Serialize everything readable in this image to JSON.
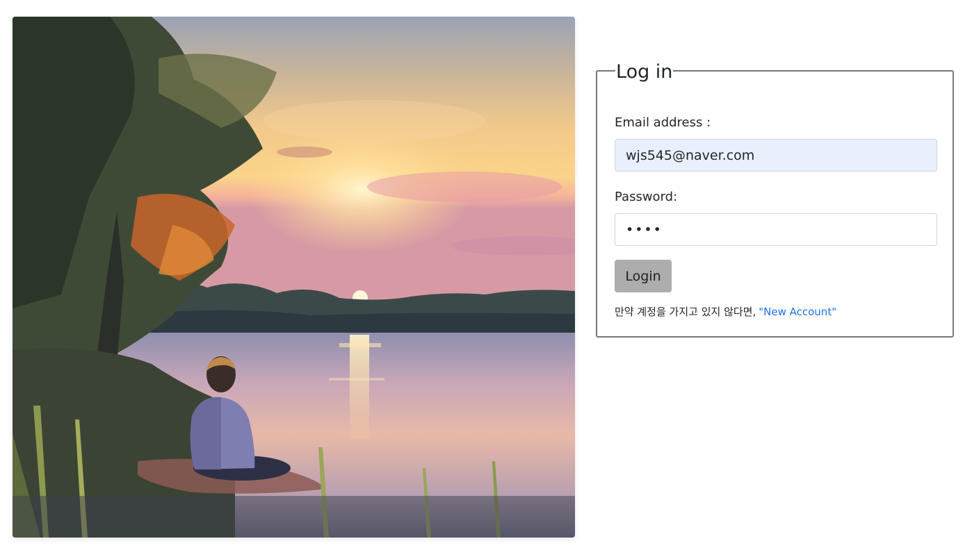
{
  "login": {
    "legend": "Log in",
    "email_label": "Email address :",
    "email_value": "wjs545@naver.com",
    "password_label": "Password:",
    "password_value": "****",
    "login_button": "Login",
    "signup_text": "만약 계정을 가지고 있지 않다면,",
    "signup_link": "\"New Account\""
  },
  "colors": {
    "email_autofill_bg": "#e8f0fe",
    "button_bg": "#adadad",
    "link": "#1a73e8",
    "card_border": "#777777"
  }
}
